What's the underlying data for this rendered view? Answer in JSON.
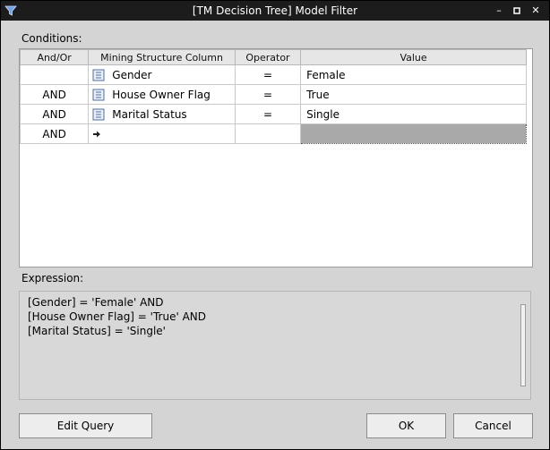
{
  "window": {
    "title": "[TM Decision Tree] Model Filter",
    "icon": "funnel-icon",
    "controls": [
      "minimize-icon",
      "maximize-icon",
      "close-icon"
    ]
  },
  "conditions": {
    "label": "Conditions:",
    "columns": [
      "And/Or",
      "Mining Structure Column",
      "Operator",
      "Value"
    ],
    "rows": [
      {
        "andor": "",
        "column": "Gender",
        "operator": "=",
        "value": "Female"
      },
      {
        "andor": "AND",
        "column": "House Owner Flag",
        "operator": "=",
        "value": "True"
      },
      {
        "andor": "AND",
        "column": "Marital Status",
        "operator": "=",
        "value": "Single"
      },
      {
        "andor": "AND",
        "column": "",
        "operator": "",
        "value": ""
      }
    ]
  },
  "expression": {
    "label": "Expression:",
    "lines": [
      "[Gender] = 'Female' AND",
      "[House Owner Flag] = 'True' AND",
      "[Marital Status] = 'Single'"
    ]
  },
  "buttons": {
    "edit_query": "Edit Query",
    "ok": "OK",
    "cancel": "Cancel"
  }
}
